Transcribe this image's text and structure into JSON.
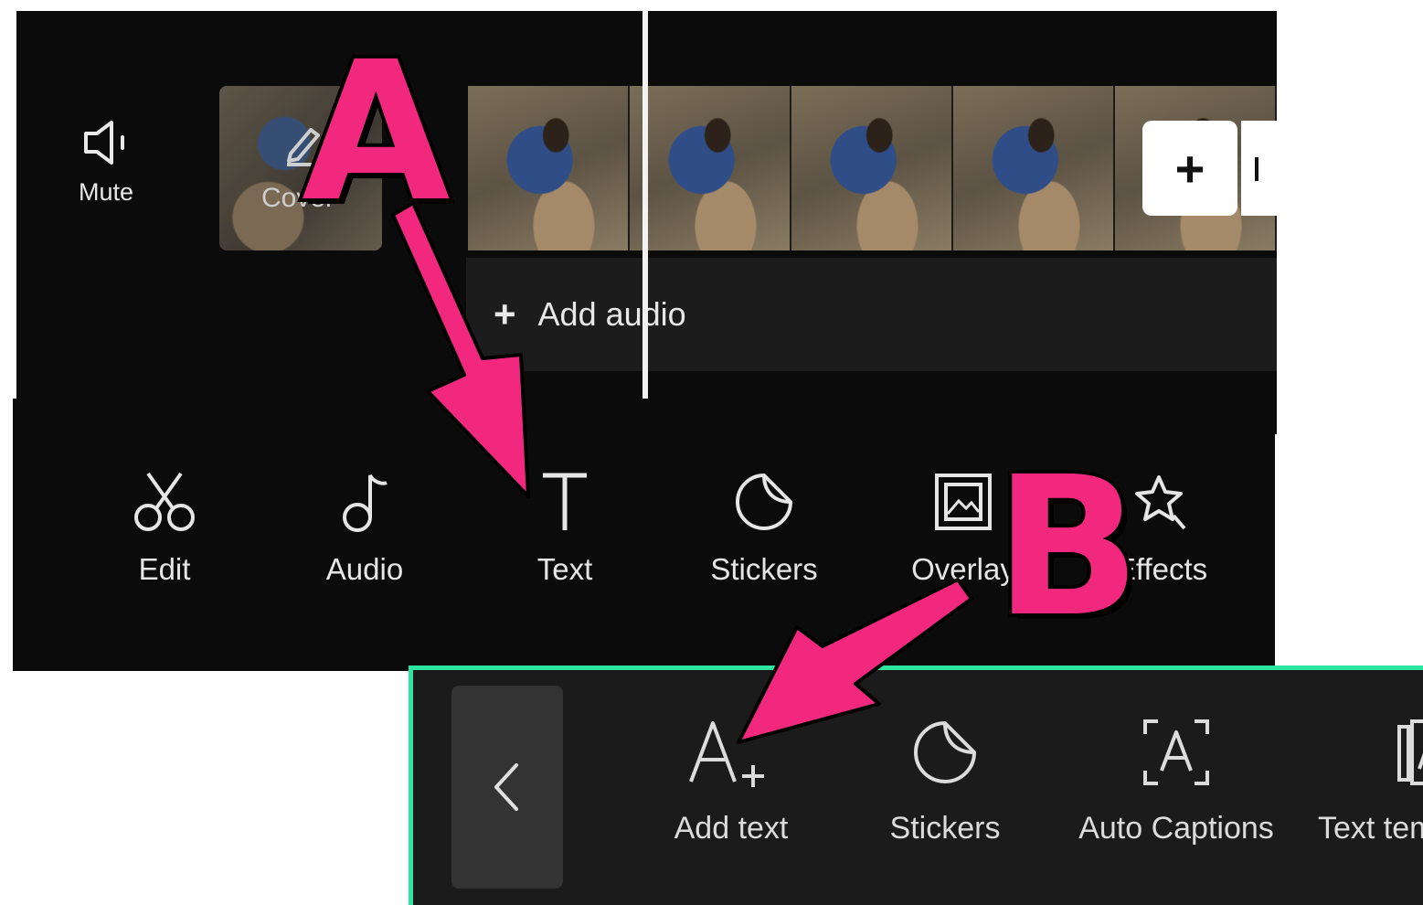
{
  "timeline": {
    "mute_label": "Mute",
    "cover_label": "Cover",
    "add_audio_label": "Add audio",
    "add_clip_symbol": "+"
  },
  "toolbar": {
    "items": [
      {
        "label": "Edit",
        "icon": "scissors-icon"
      },
      {
        "label": "Audio",
        "icon": "music-note-icon"
      },
      {
        "label": "Text",
        "icon": "text-t-icon"
      },
      {
        "label": "Stickers",
        "icon": "sticker-icon"
      },
      {
        "label": "Overlay",
        "icon": "overlay-picture-icon"
      },
      {
        "label": "Effects",
        "icon": "effects-star-icon"
      }
    ]
  },
  "text_panel": {
    "items": [
      {
        "label": "Add text",
        "icon": "add-text-icon"
      },
      {
        "label": "Stickers",
        "icon": "sticker-icon"
      },
      {
        "label": "Auto Captions",
        "icon": "auto-captions-icon"
      },
      {
        "label": "Text template",
        "icon": "text-template-icon"
      }
    ]
  },
  "annotations": {
    "label_a": "A",
    "label_b": "B"
  },
  "colors": {
    "annotation_pink": "#f2287f",
    "panel_border_green": "#2fe6a0",
    "dark_background": "#0b0b0b"
  }
}
